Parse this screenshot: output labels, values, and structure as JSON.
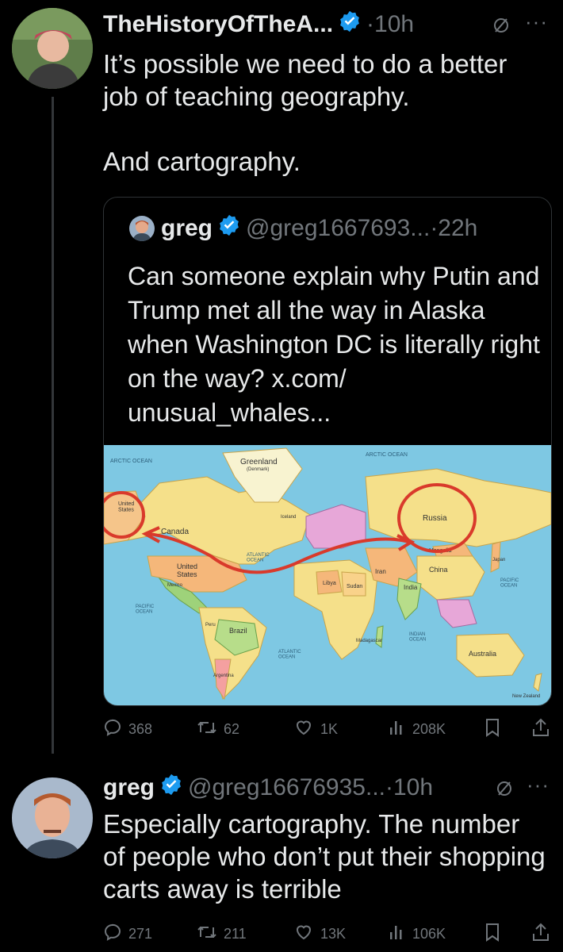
{
  "tweet1": {
    "display_name": "TheHistoryOfTheA...",
    "time": "·10h",
    "text": "It’s possible we need to do a better job of teaching geography.\n\nAnd cartography."
  },
  "quote": {
    "display_name": "greg",
    "handle": "@greg1667693...",
    "time": "·22h",
    "text": "Can someone explain why Putin and Trump met all the way in Alaska when Washington DC is literally right on the way? x.com/\nunusual_whales...",
    "map_labels": {
      "arctic_left": "ARCTIC OCEAN",
      "arctic_right": "ARCTIC OCEAN",
      "greenland": "Greenland",
      "greenland_sub": "(Denmark)",
      "us_alaska": "United\nStates",
      "canada": "Canada",
      "united_states": "United\nStates",
      "atlantic_n": "ATLANTIC\nOCEAN",
      "atlantic_s": "ATLANTIC\nOCEAN",
      "pacific_left": "PACIFIC\nOCEAN",
      "pacific_right": "PACIFIC\nOCEAN",
      "russia": "Russia",
      "mongolia": "Mongolia",
      "china": "China",
      "india": "India",
      "iran": "Iran",
      "libya": "Libya",
      "sudan": "Sudan",
      "brazil": "Brazil",
      "australia": "Australia",
      "indian_ocean": "INDIAN\nOCEAN",
      "new_zealand": "New Zealand",
      "iceland": "Iceland",
      "mexico": "Mexico",
      "japan": "Japan",
      "madagascar": "Madagascar",
      "argentina": "Argentina",
      "peru": "Peru"
    }
  },
  "tweet1_actions": {
    "replies": "368",
    "reposts": "62",
    "likes": "1K",
    "views": "208K"
  },
  "tweet2": {
    "display_name": "greg",
    "handle": "@greg16676935...",
    "time": "·10h",
    "text": "Especially cartography. The number of people who don’t put their shopping carts away is terrible"
  },
  "tweet2_actions": {
    "replies": "271",
    "reposts": "211",
    "likes": "13K",
    "views": "106K"
  },
  "colors": {
    "background": "#000000",
    "text": "#e7e9ea",
    "muted": "#71767b",
    "verified": "#1d9bf0",
    "ocean": "#7ec8e3",
    "annotation": "#d93a2b"
  },
  "icons": [
    "verified-badge-icon",
    "grok-icon",
    "more-icon",
    "reply-icon",
    "repost-icon",
    "like-icon",
    "views-icon",
    "bookmark-icon",
    "share-icon"
  ]
}
